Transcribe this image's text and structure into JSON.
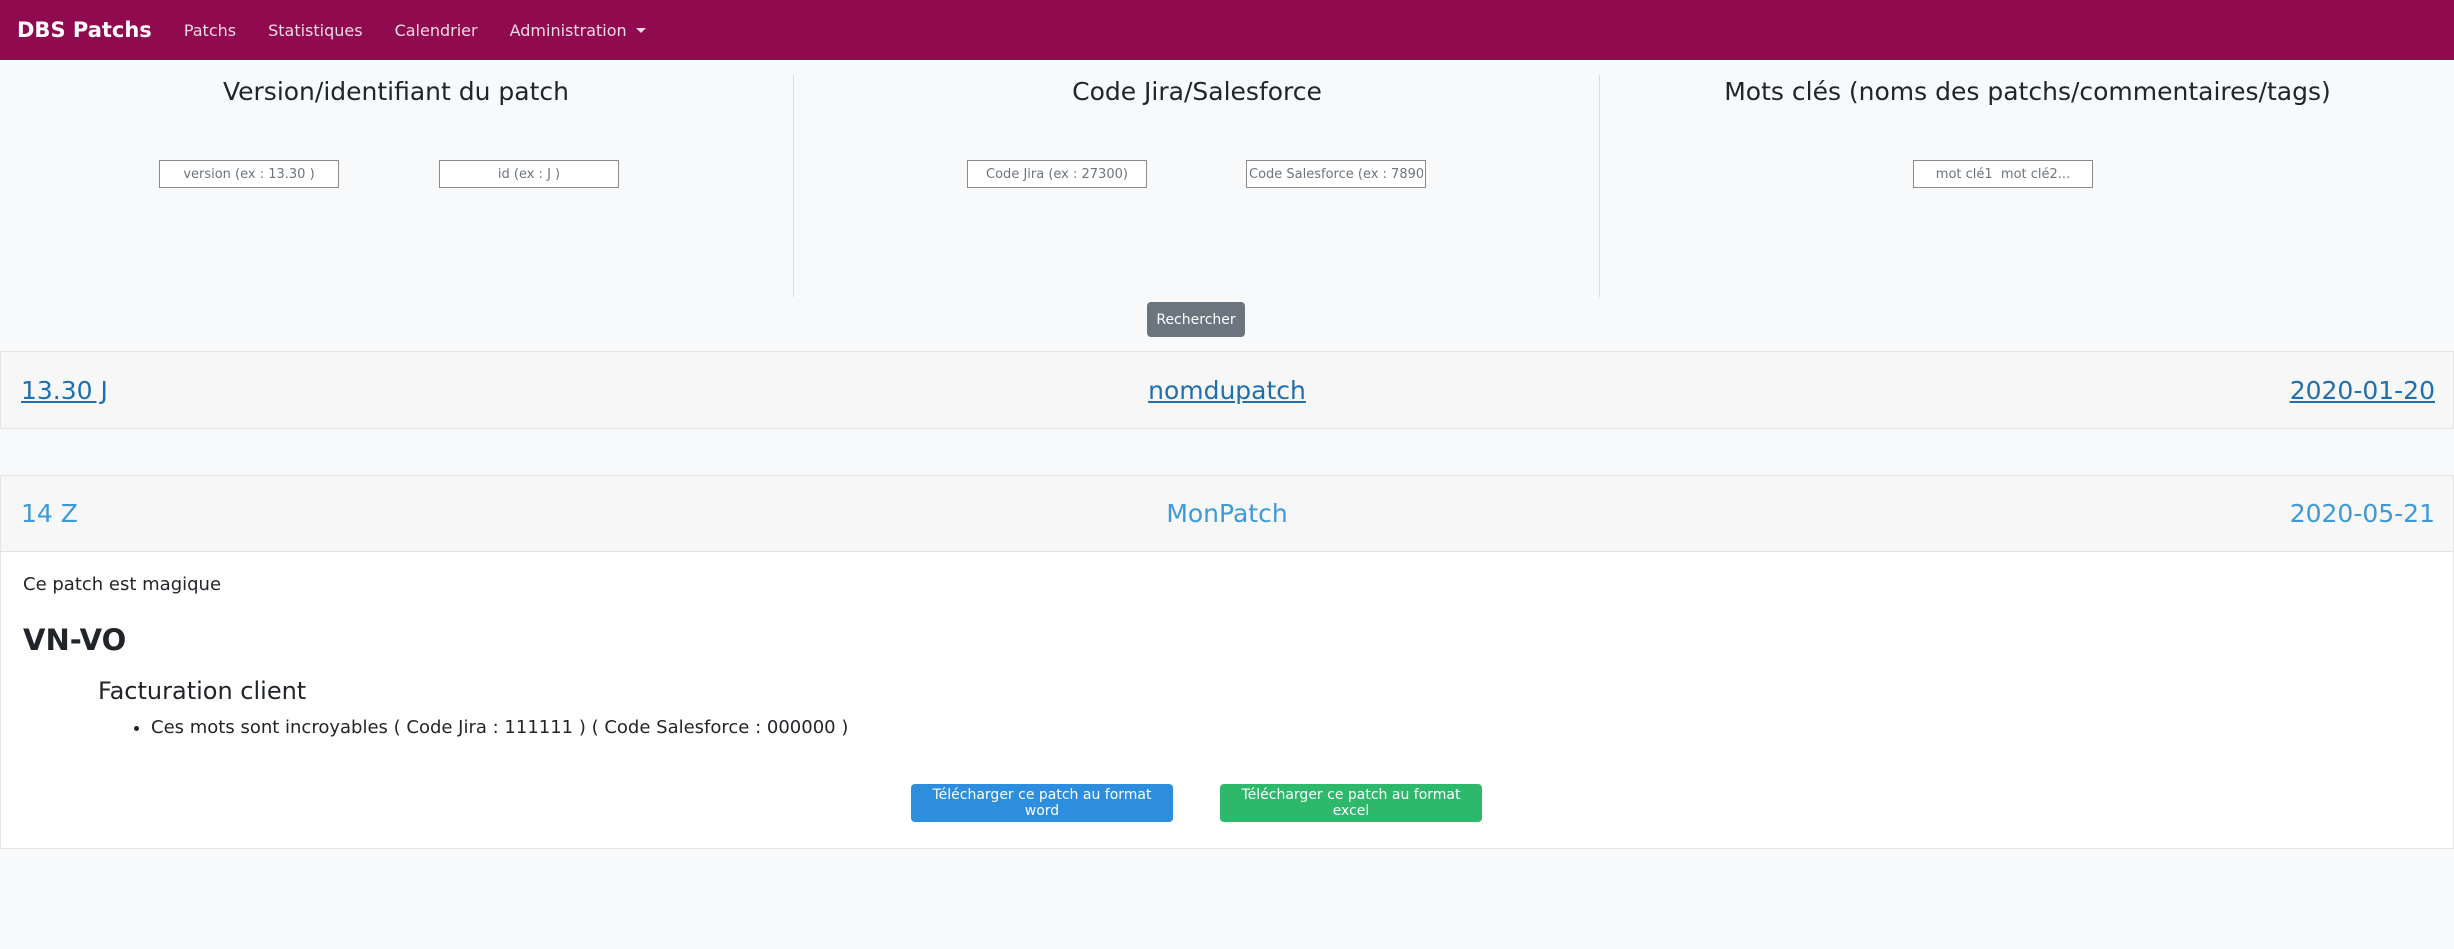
{
  "navbar": {
    "brand": "DBS Patchs",
    "items": [
      "Patchs",
      "Statistiques",
      "Calendrier",
      "Administration"
    ]
  },
  "search": {
    "col1_title": "Version/identifiant du patch",
    "version_placeholder": "version (ex : 13.30 )",
    "id_placeholder": "id (ex : J )",
    "col2_title": "Code Jira/Salesforce",
    "jira_placeholder": "Code Jira (ex : 27300)",
    "salesforce_placeholder": "Code Salesforce (ex : 7890)",
    "col3_title": "Mots clés (noms des patchs/commentaires/tags)",
    "keywords_placeholder": "mot clé1  mot clé2...",
    "button": "Rechercher"
  },
  "patches": [
    {
      "version": "13.30 J",
      "name": "nomdupatch",
      "date": "2020-01-20"
    },
    {
      "version": "14 Z",
      "name": "MonPatch",
      "date": "2020-05-21",
      "description": "Ce patch est magique",
      "category": "VN-VO",
      "subcategory": "Facturation client",
      "items": [
        "Ces mots sont incroyables ( Code Jira : 111111 ) ( Code Salesforce : 000000 )"
      ],
      "word_button": "Télécharger ce patch au format word",
      "excel_button": "Télécharger ce patch au format excel"
    }
  ],
  "colors": {
    "navbar": "#8f0a4e",
    "link": "#1f6fb0",
    "link_light": "#3d9ad7",
    "word": "#2d8ede",
    "excel": "#2eb86b"
  }
}
